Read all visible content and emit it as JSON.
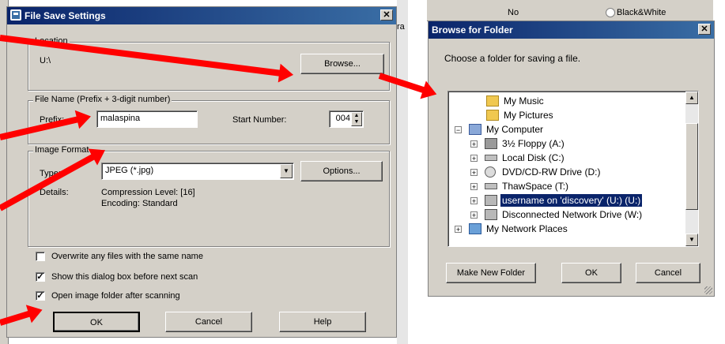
{
  "save_dialog": {
    "title": "File Save Settings",
    "location": {
      "group_label": "Location",
      "path": "U:\\",
      "browse_label": "Browse..."
    },
    "file_name": {
      "group_label": "File Name (Prefix + 3-digit number)",
      "prefix_label": "Prefix:",
      "prefix_value": "malaspina",
      "start_number_label": "Start Number:",
      "start_number_value": "004"
    },
    "image_format": {
      "group_label": "Image Format",
      "type_label": "Type:",
      "type_value": "JPEG (*.jpg)",
      "options_label": "Options...",
      "details_label": "Details:",
      "compression": "Compression Level: [16]",
      "encoding": "Encoding: Standard"
    },
    "checkboxes": [
      {
        "label": "Overwrite any files with the same name",
        "checked": false
      },
      {
        "label": "Show this dialog box before next scan",
        "checked": true
      },
      {
        "label": "Open image folder after scanning",
        "checked": true
      }
    ],
    "buttons": {
      "ok": "OK",
      "cancel": "Cancel",
      "help": "Help"
    },
    "background_fragment": "ra"
  },
  "browse_dialog": {
    "title": "Browse for Folder",
    "instruction": "Choose a folder for saving a file.",
    "tree_items": [
      {
        "label": "My Music",
        "icon": "music-folder-icon"
      },
      {
        "label": "My Pictures",
        "icon": "pictures-folder-icon"
      },
      {
        "label": "My Computer",
        "icon": "computer-icon"
      },
      {
        "label": "3½ Floppy (A:)",
        "icon": "floppy-icon"
      },
      {
        "label": "Local Disk (C:)",
        "icon": "disk-icon"
      },
      {
        "label": "DVD/CD-RW Drive (D:)",
        "icon": "cd-drive-icon"
      },
      {
        "label": "ThawSpace (T:)",
        "icon": "disk-icon"
      },
      {
        "label": "username on 'discovery' (U:) (U:)",
        "icon": "network-drive-icon",
        "selected": true
      },
      {
        "label": "Disconnected Network Drive (W:)",
        "icon": "disconnected-drive-icon"
      },
      {
        "label": "My Network Places",
        "icon": "network-places-icon"
      }
    ],
    "buttons": {
      "new_folder": "Make New Folder",
      "ok": "OK",
      "cancel": "Cancel"
    },
    "background_fragments": {
      "left": "No",
      "right": "Black&White"
    }
  },
  "colors": {
    "annotation_arrow": "#ff0000",
    "title_bar": "#0a246a",
    "selection": "#0a246a"
  }
}
